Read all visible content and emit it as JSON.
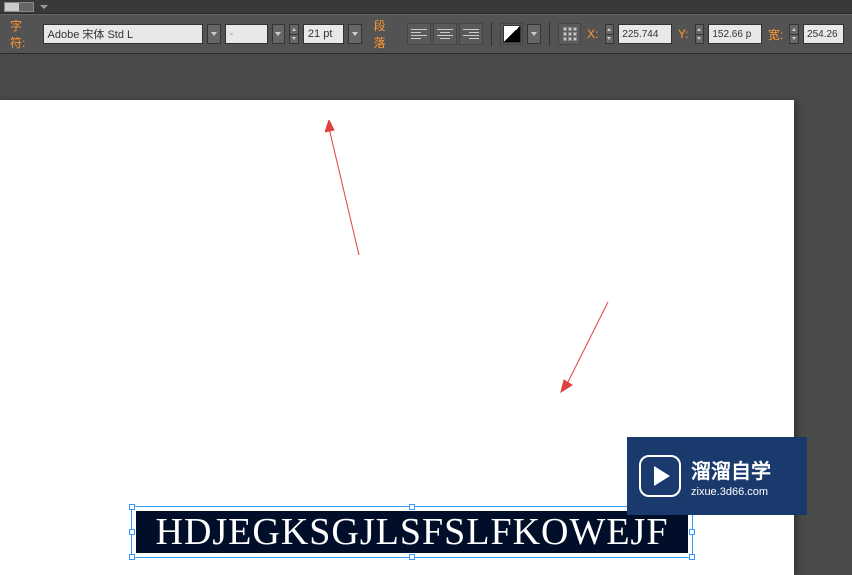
{
  "toolbar": {
    "char_label": "字符:",
    "font_family": "Adobe 宋体 Std L",
    "font_style": "-",
    "font_size": "21 pt",
    "paragraph_label": "段落",
    "x_label": "X:",
    "x_value": "225.744",
    "y_label": "Y:",
    "y_value": "152.66 p",
    "w_label": "宽:",
    "w_value": "254.26"
  },
  "canvas": {
    "selected_text": "HDJEGKSGJLSFSLFKOWEJF"
  },
  "watermark": {
    "title": "溜溜自学",
    "url": "zixue.3d66.com"
  }
}
